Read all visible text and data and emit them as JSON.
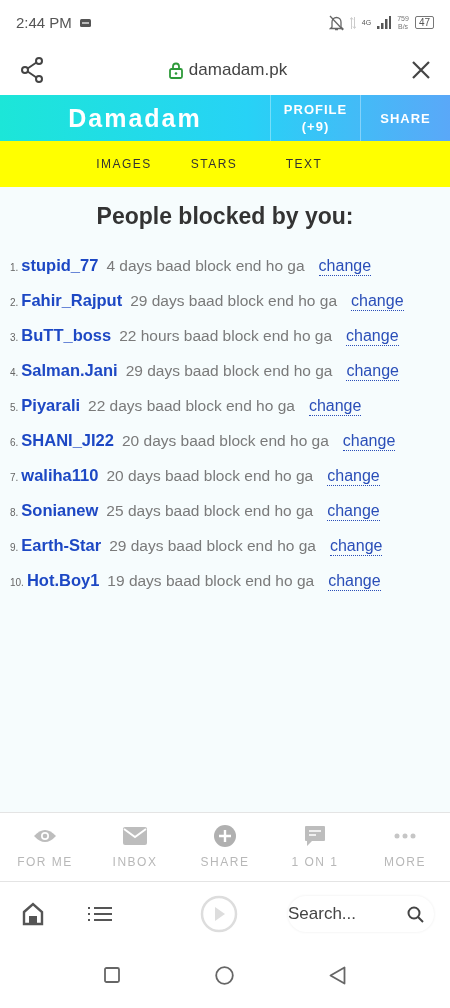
{
  "status_bar": {
    "time": "2:44 PM",
    "network": "4G",
    "speed": "759",
    "speed_unit": "B/s",
    "battery": "47"
  },
  "browser": {
    "url": "damadam.pk"
  },
  "header": {
    "logo": "Damadam",
    "buttons": [
      {
        "label": "PROFILE",
        "sub": "(+9)"
      },
      {
        "label": "SHARE"
      }
    ]
  },
  "nav": [
    "IMAGES",
    "STARS",
    "TEXT"
  ],
  "title": "People blocked by you:",
  "blocked": [
    {
      "number": "1.",
      "name": "stupid_77",
      "note": "4 days baad block end ho ga",
      "action": "change"
    },
    {
      "number": "2.",
      "name": "Fahir_Rajput",
      "note": "29 days baad block end ho ga",
      "action": "change"
    },
    {
      "number": "3.",
      "name": "BuTT_boss",
      "note": "22 hours baad block end ho ga",
      "action": "change"
    },
    {
      "number": "4.",
      "name": "Salman.Jani",
      "note": "29 days baad block end ho ga",
      "action": "change"
    },
    {
      "number": "5.",
      "name": "Piyarali",
      "note": "22 days baad block end ho ga",
      "action": "change"
    },
    {
      "number": "6.",
      "name": "SHANI_JI22",
      "note": "20 days baad block end ho ga",
      "action": "change"
    },
    {
      "number": "7.",
      "name": "waliha110",
      "note": "20 days baad block end ho ga",
      "action": "change"
    },
    {
      "number": "8.",
      "name": "Sonianew",
      "note": "25 days baad block end ho ga",
      "action": "change"
    },
    {
      "number": "9.",
      "name": "Earth-Star",
      "note": "29 days baad block end ho ga",
      "action": "change"
    },
    {
      "number": "10.",
      "name": "Hot.Boy1",
      "note": "19 days baad block end ho ga",
      "action": "change"
    }
  ],
  "bottom_nav": [
    {
      "kind": "eye",
      "label": "FOR ME"
    },
    {
      "kind": "mail",
      "label": "INBOX"
    },
    {
      "kind": "plus",
      "label": "SHARE"
    },
    {
      "kind": "chat",
      "label": "1 ON 1"
    },
    {
      "kind": "dots",
      "label": "MORE"
    }
  ],
  "search": {
    "placeholder": "Search..."
  }
}
